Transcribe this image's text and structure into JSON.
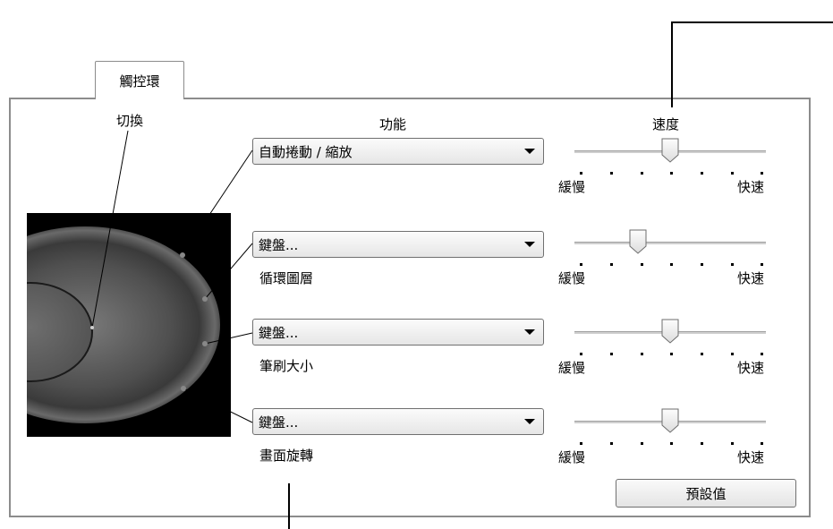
{
  "tab": {
    "label": "觸控環"
  },
  "headers": {
    "toggle": "切換",
    "function": "功能",
    "speed": "速度"
  },
  "rows": [
    {
      "dropdown": "自動捲動 / 縮放",
      "sub_label": "",
      "slider_value": 0.5
    },
    {
      "dropdown": "鍵盤...",
      "sub_label": "循環圖層",
      "slider_value": 0.33
    },
    {
      "dropdown": "鍵盤...",
      "sub_label": "筆刷大小",
      "slider_value": 0.5
    },
    {
      "dropdown": "鍵盤...",
      "sub_label": "畫面旋轉",
      "slider_value": 0.5
    }
  ],
  "slider_labels": {
    "slow": "緩慢",
    "fast": "快速"
  },
  "default_button": "預設值",
  "colors": {
    "panel_border": "#8c8c8c",
    "touchring_bg": "#000000"
  }
}
